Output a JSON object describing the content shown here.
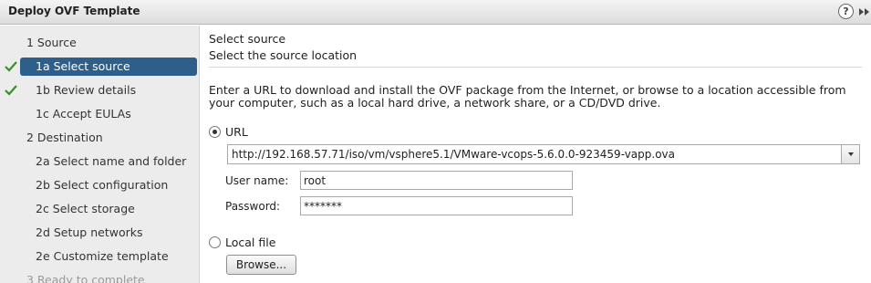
{
  "window": {
    "title": "Deploy OVF Template",
    "help_glyph": "?"
  },
  "nav": {
    "steps": [
      {
        "label": "1  Source",
        "state": "normal",
        "completed": false
      },
      {
        "label": "1a  Select source",
        "state": "selected",
        "completed": true
      },
      {
        "label": "1b  Review details",
        "state": "normal",
        "completed": true
      },
      {
        "label": "1c  Accept EULAs",
        "state": "normal",
        "completed": false
      },
      {
        "label": "2  Destination",
        "state": "normal",
        "completed": false
      },
      {
        "label": "2a  Select name and folder",
        "state": "normal",
        "completed": false
      },
      {
        "label": "2b  Select configuration",
        "state": "normal",
        "completed": false
      },
      {
        "label": "2c  Select storage",
        "state": "normal",
        "completed": false
      },
      {
        "label": "2d  Setup networks",
        "state": "normal",
        "completed": false
      },
      {
        "label": "2e  Customize template",
        "state": "normal",
        "completed": false
      },
      {
        "label": "3  Ready to complete",
        "state": "dim",
        "completed": false
      }
    ],
    "check_color": "#3a8d2b",
    "selected_color": "#2e5f8a"
  },
  "main": {
    "heading": "Select source",
    "subheading": "Select the source location",
    "description": "Enter a URL to download and install the OVF package from the Internet, or browse to a location accessible from your computer, such as a local hard drive, a network share, or a CD/DVD drive.",
    "url_option": {
      "label": "URL",
      "selected": true
    },
    "url_value": "http://192.168.57.71/iso/vm/vsphere5.1/VMware-vcops-5.6.0.0-923459-vapp.ova",
    "username": {
      "label": "User name:",
      "value": "root"
    },
    "password": {
      "label": "Password:",
      "value": "*******"
    },
    "local_file_option": {
      "label": "Local file",
      "selected": false
    },
    "browse_label": "Browse..."
  }
}
